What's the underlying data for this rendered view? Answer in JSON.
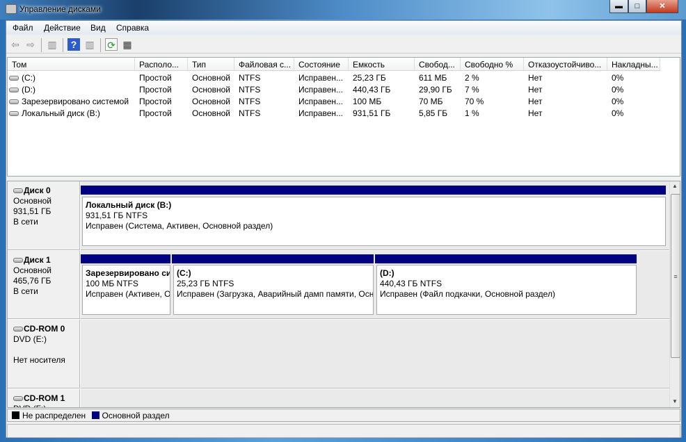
{
  "window": {
    "title": "Управление дисками",
    "minimize": "▬",
    "maximize": "□",
    "close": "✕"
  },
  "menu": [
    "Файл",
    "Действие",
    "Вид",
    "Справка"
  ],
  "toolbar": {
    "back": "⇦",
    "forward": "⇨",
    "panel1": "▥",
    "help": "?",
    "panel2": "▥",
    "refresh": "⟳",
    "properties": "▦"
  },
  "columns": [
    "Том",
    "Располо...",
    "Тип",
    "Файловая с...",
    "Состояние",
    "Емкость",
    "Свобод...",
    "Свободно %",
    "Отказоустойчиво...",
    "Накладны..."
  ],
  "volumes": [
    [
      "(C:)",
      "Простой",
      "Основной",
      "NTFS",
      "Исправен...",
      "25,23 ГБ",
      "611 МБ",
      "2 %",
      "Нет",
      "0%"
    ],
    [
      "(D:)",
      "Простой",
      "Основной",
      "NTFS",
      "Исправен...",
      "440,43 ГБ",
      "29,90 ГБ",
      "7 %",
      "Нет",
      "0%"
    ],
    [
      "Зарезервировано системой",
      "Простой",
      "Основной",
      "NTFS",
      "Исправен...",
      "100 МБ",
      "70 МБ",
      "70 %",
      "Нет",
      "0%"
    ],
    [
      "Локальный диск (B:)",
      "Простой",
      "Основной",
      "NTFS",
      "Исправен...",
      "931,51 ГБ",
      "5,85 ГБ",
      "1 %",
      "Нет",
      "0%"
    ]
  ],
  "disks": [
    {
      "name": "Диск 0",
      "type": "Основной",
      "size": "931,51 ГБ",
      "state": "В сети",
      "partitions": [
        {
          "title": "Локальный диск  (B:)",
          "size": "931,51 ГБ NTFS",
          "status": "Исправен (Система, Активен, Основной раздел)"
        }
      ]
    },
    {
      "name": "Диск 1",
      "type": "Основной",
      "size": "465,76 ГБ",
      "state": "В сети",
      "partitions": [
        {
          "title": "Зарезервировано системой",
          "size": "100 МБ NTFS",
          "status": "Исправен (Активен, Основной раздел)"
        },
        {
          "title": " (C:)",
          "size": "25,23 ГБ NTFS",
          "status": "Исправен (Загрузка, Аварийный дамп памяти, Основной раздел)"
        },
        {
          "title": " (D:)",
          "size": "440,43 ГБ NTFS",
          "status": "Исправен (Файл подкачки, Основной раздел)"
        }
      ]
    },
    {
      "name": "CD-ROM 0",
      "type": "DVD (E:)",
      "state": "Нет носителя"
    },
    {
      "name": "CD-ROM 1",
      "type": "DVD (F:)"
    }
  ],
  "legend": [
    {
      "label": "Не распределен",
      "color": "#000000"
    },
    {
      "label": "Основной раздел",
      "color": "#000080"
    }
  ],
  "scroll": {
    "up": "▲",
    "down": "▼",
    "grip": "≡"
  }
}
